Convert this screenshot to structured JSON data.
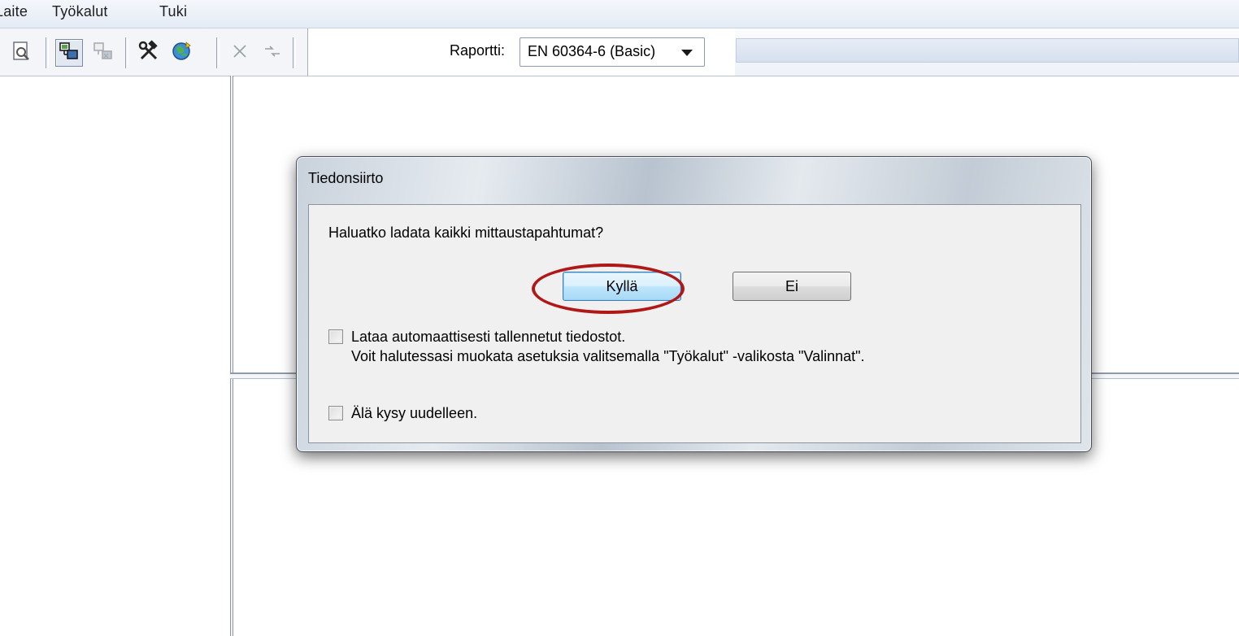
{
  "menu": {
    "items": [
      "Laite",
      "Työkalut",
      "Tuki"
    ]
  },
  "toolbar": {
    "buttons": [
      {
        "icon": "print-preview-icon",
        "enabled": true
      },
      {
        "icon": "connect-device-icon",
        "enabled": true,
        "pressed": true
      },
      {
        "icon": "disconnect-device-icon",
        "enabled": false
      },
      {
        "icon": "tools-icon",
        "enabled": true
      },
      {
        "icon": "globe-update-icon",
        "enabled": true
      },
      {
        "icon": "delete-icon",
        "enabled": false
      },
      {
        "icon": "transfer-icon",
        "enabled": false
      }
    ],
    "report_label": "Raportti:",
    "report_value": "EN 60364-6 (Basic)"
  },
  "dialog": {
    "title": "Tiedonsiirto",
    "question": "Haluatko ladata kaikki mittaustapahtumat?",
    "yes_label": "Kyllä",
    "no_label": "Ei",
    "auto_load_line1": "Lataa automaattisesti tallennetut tiedostot.",
    "auto_load_line2": "Voit halutessasi muokata asetuksia valitsemalla \"Työkalut\" -valikosta \"Valinnat\".",
    "auto_load_checked": false,
    "dont_ask_label": "Älä kysy uudelleen.",
    "dont_ask_checked": false
  },
  "colors": {
    "highlight": "#b01818",
    "default_button_border": "#3c7fb1"
  }
}
